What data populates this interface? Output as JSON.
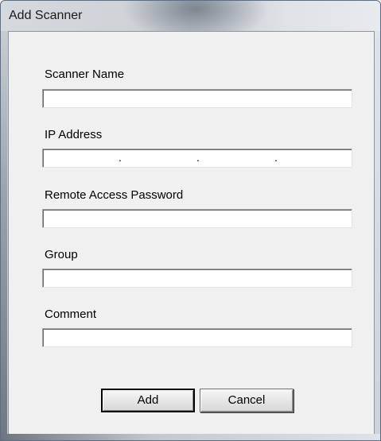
{
  "window": {
    "title": "Add Scanner"
  },
  "form": {
    "scanner_name": {
      "label": "Scanner Name",
      "value": ""
    },
    "ip_address": {
      "label": "IP Address",
      "octets": [
        "",
        "",
        "",
        ""
      ],
      "separator": "."
    },
    "remote_password": {
      "label": "Remote Access Password",
      "value": ""
    },
    "group": {
      "label": "Group",
      "value": ""
    },
    "comment": {
      "label": "Comment",
      "value": ""
    }
  },
  "buttons": {
    "add_label": "Add",
    "cancel_label": "Cancel"
  },
  "colors": {
    "client_bg": "#f0f0f0",
    "input_bg": "#ffffff",
    "default_button_border": "#000000"
  }
}
